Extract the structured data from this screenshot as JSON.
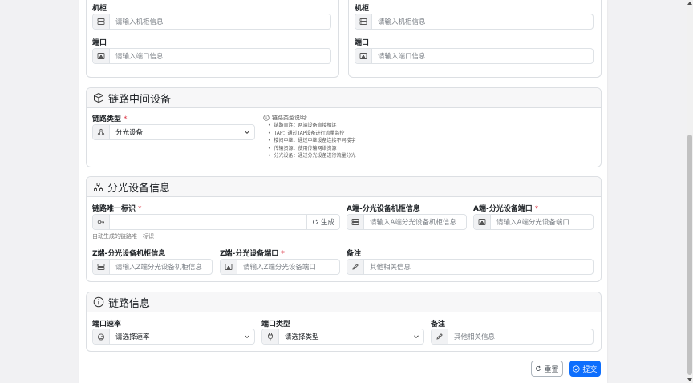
{
  "top_left": {
    "cabinet_label": "机柜",
    "cabinet_placeholder": "请输入机柜信息",
    "port_label": "端口",
    "port_placeholder": "请输入端口信息"
  },
  "top_right": {
    "cabinet_label": "机柜",
    "cabinet_placeholder": "请输入机柜信息",
    "port_label": "端口",
    "port_placeholder": "请输入端口信息"
  },
  "middle_device": {
    "title": "链路中间设备",
    "link_type_label": "链路类型",
    "link_type_value": "分光设备",
    "info_title": "链路类型说明:",
    "info_items": [
      "链路直连：两端设备直接相连",
      "TAP：通过TAP设备进行流量监控",
      "楼间中继：通过中继设备连接不同楼宇",
      "传输资源：使用传输网络资源",
      "分光设备：通过分光设备进行流量分光"
    ]
  },
  "splitter": {
    "title": "分光设备信息",
    "link_id_label": "链路唯一标识",
    "link_id_value": "",
    "generate_label": "生成",
    "link_id_help": "自动生成的链路唯一标识",
    "a_cabinet_label": "A端-分光设备机柜信息",
    "a_cabinet_placeholder": "请输入A端分光设备机柜信息",
    "a_port_label": "A端-分光设备端口",
    "a_port_placeholder": "请输入A端分光设备端口",
    "z_cabinet_label": "Z端-分光设备机柜信息",
    "z_cabinet_placeholder": "请输入Z端分光设备机柜信息",
    "z_port_label": "Z端-分光设备端口",
    "z_port_placeholder": "请输入Z端分光设备端口",
    "remark_label": "备注",
    "remark_placeholder": "其他相关信息"
  },
  "link_info": {
    "title": "链路信息",
    "rate_label": "端口速率",
    "rate_placeholder": "请选择速率",
    "port_type_label": "端口类型",
    "port_type_placeholder": "请选择类型",
    "remark_label": "备注",
    "remark_placeholder": "其他相关信息"
  },
  "actions": {
    "reset_label": "重置",
    "submit_label": "提交"
  },
  "colors": {
    "primary": "#0d6efd",
    "required": "#dc3545"
  }
}
